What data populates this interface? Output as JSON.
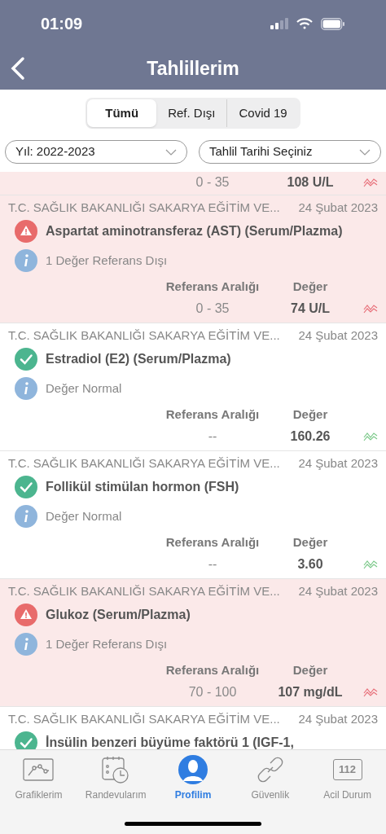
{
  "status_bar": {
    "time": "01:09"
  },
  "nav": {
    "title": "Tahlillerim"
  },
  "segments": [
    {
      "label": "Tümü",
      "selected": true
    },
    {
      "label": "Ref. Dışı",
      "selected": false
    },
    {
      "label": "Covid 19",
      "selected": false
    }
  ],
  "filters": [
    {
      "value": "Yıl: 2022-2023"
    },
    {
      "value": "Tahlil Tarihi Seçiniz"
    }
  ],
  "partial_row": {
    "kind": "abnormal",
    "range": "0 - 35",
    "value": "108 U/L"
  },
  "results": [
    {
      "kind": "abnormal",
      "source": "T.C. SAĞLIK BAKANLIĞI SAKARYA EĞİTİM VE...",
      "date": "24 Şubat 2023",
      "title": "Aspartat aminotransferaz (AST) (Serum/Plazma)",
      "info": "1 Değer Referans Dışı",
      "range_label": "Referans Aralığı",
      "value_label": "Değer",
      "range": "0 - 35",
      "value": "74 U/L"
    },
    {
      "kind": "normal",
      "source": "T.C. SAĞLIK BAKANLIĞI SAKARYA EĞİTİM VE...",
      "date": "24 Şubat 2023",
      "title": "Estradiol (E2) (Serum/Plazma)",
      "info": "Değer Normal",
      "range_label": "Referans Aralığı",
      "value_label": "Değer",
      "range": "--",
      "value": "160.26"
    },
    {
      "kind": "normal",
      "source": "T.C. SAĞLIK BAKANLIĞI SAKARYA EĞİTİM VE...",
      "date": "24 Şubat 2023",
      "title": "Follikül stimülan hormon (FSH)",
      "info": "Değer Normal",
      "range_label": "Referans Aralığı",
      "value_label": "Değer",
      "range": "--",
      "value": "3.60"
    },
    {
      "kind": "abnormal",
      "source": "T.C. SAĞLIK BAKANLIĞI SAKARYA EĞİTİM VE...",
      "date": "24 Şubat 2023",
      "title": "Glukoz (Serum/Plazma)",
      "info": "1 Değer Referans Dışı",
      "range_label": "Referans Aralığı",
      "value_label": "Değer",
      "range": "70 - 100",
      "value": "107 mg/dL"
    },
    {
      "kind": "normal",
      "source": "T.C. SAĞLIK BAKANLIĞI SAKARYA EĞİTİM VE...",
      "date": "24 Şubat 2023",
      "title": "İnsülin benzeri büyüme faktörü 1 (IGF-1,"
    }
  ],
  "tab_bar": [
    {
      "kind": "chart",
      "label": "Grafiklerim",
      "selected": false
    },
    {
      "kind": "calendar",
      "label": "Randevularım",
      "selected": false
    },
    {
      "kind": "profile",
      "label": "Profilim",
      "selected": true
    },
    {
      "kind": "link",
      "label": "Güvenlik",
      "selected": false
    },
    {
      "kind": "emergency",
      "label": "Acil Durum",
      "badge": "112",
      "selected": false
    }
  ]
}
